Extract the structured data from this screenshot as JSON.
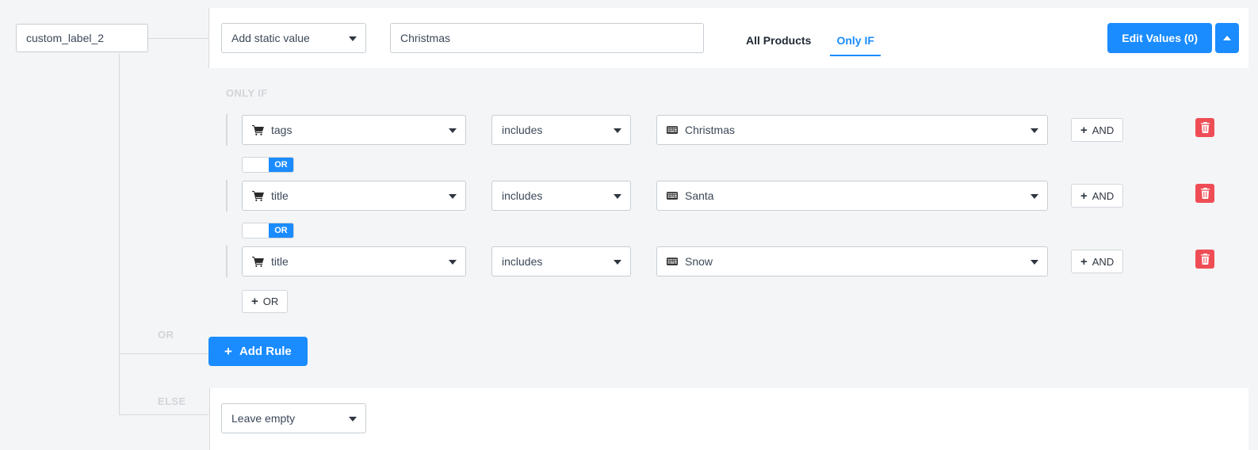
{
  "field": {
    "name": "custom_label_2"
  },
  "header": {
    "action": {
      "label": "Add static value",
      "icon": "chevron-down-icon"
    },
    "value": {
      "text": "Christmas",
      "placeholder": ""
    },
    "tabs": [
      {
        "label": "All Products",
        "active": false
      },
      {
        "label": "Only IF",
        "active": true
      }
    ],
    "edit_values_button": "Edit Values (0)",
    "collapse_button_icon": "chevron-up-icon"
  },
  "only_if": {
    "section_label": "ONLY IF",
    "rules": [
      {
        "field": {
          "label": "tags",
          "icon": "shopping-cart-icon"
        },
        "operator": {
          "label": "includes"
        },
        "value": {
          "label": "Christmas",
          "icon": "keyboard-icon"
        },
        "and_button": "AND",
        "delete_icon": "trash-icon"
      },
      {
        "field": {
          "label": "title",
          "icon": "shopping-cart-icon"
        },
        "operator": {
          "label": "includes"
        },
        "value": {
          "label": "Santa",
          "icon": "keyboard-icon"
        },
        "and_button": "AND",
        "delete_icon": "trash-icon"
      },
      {
        "field": {
          "label": "title",
          "icon": "shopping-cart-icon"
        },
        "operator": {
          "label": "includes"
        },
        "value": {
          "label": "Snow",
          "icon": "keyboard-icon"
        },
        "and_button": "AND",
        "delete_icon": "trash-icon"
      }
    ],
    "or_toggles": [
      "OR",
      "OR"
    ],
    "add_or_button": "OR"
  },
  "rail": {
    "or_label": "OR",
    "else_label": "ELSE"
  },
  "add_rule_button": "Add Rule",
  "else_section": {
    "action": {
      "label": "Leave empty"
    }
  },
  "colors": {
    "accent_blue": "#1a8cff",
    "danger_red": "#ef4d56",
    "background": "#f4f5f6",
    "panel": "#ffffff",
    "border": "#c7ced4",
    "muted_label": "#d2d5d9"
  }
}
